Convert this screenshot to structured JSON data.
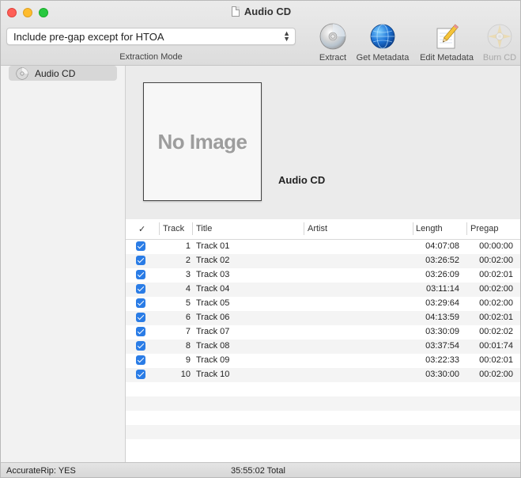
{
  "window": {
    "title": "Audio CD"
  },
  "toolbar": {
    "mode_value": "Include pre-gap except for HTOA",
    "mode_caption": "Extraction Mode",
    "extract_label": "Extract",
    "get_metadata_label": "Get Metadata",
    "edit_metadata_label": "Edit Metadata",
    "burn_cd_label": "Burn CD"
  },
  "sidebar": {
    "items": [
      {
        "label": "Audio CD"
      }
    ]
  },
  "album": {
    "cover_placeholder": "No Image",
    "title": "Audio CD"
  },
  "table": {
    "headers": {
      "check": "✓",
      "track": "Track",
      "title": "Title",
      "artist": "Artist",
      "length": "Length",
      "pregap": "Pregap"
    },
    "rows": [
      {
        "checked": true,
        "track": "1",
        "title": "Track 01",
        "artist": "",
        "length": "04:07:08",
        "pregap": "00:00:00"
      },
      {
        "checked": true,
        "track": "2",
        "title": "Track 02",
        "artist": "",
        "length": "03:26:52",
        "pregap": "00:02:00"
      },
      {
        "checked": true,
        "track": "3",
        "title": "Track 03",
        "artist": "",
        "length": "03:26:09",
        "pregap": "00:02:01"
      },
      {
        "checked": true,
        "track": "4",
        "title": "Track 04",
        "artist": "",
        "length": "03:11:14",
        "pregap": "00:02:00"
      },
      {
        "checked": true,
        "track": "5",
        "title": "Track 05",
        "artist": "",
        "length": "03:29:64",
        "pregap": "00:02:00"
      },
      {
        "checked": true,
        "track": "6",
        "title": "Track 06",
        "artist": "",
        "length": "04:13:59",
        "pregap": "00:02:01"
      },
      {
        "checked": true,
        "track": "7",
        "title": "Track 07",
        "artist": "",
        "length": "03:30:09",
        "pregap": "00:02:02"
      },
      {
        "checked": true,
        "track": "8",
        "title": "Track 08",
        "artist": "",
        "length": "03:37:54",
        "pregap": "00:01:74"
      },
      {
        "checked": true,
        "track": "9",
        "title": "Track 09",
        "artist": "",
        "length": "03:22:33",
        "pregap": "00:02:01"
      },
      {
        "checked": true,
        "track": "10",
        "title": "Track 10",
        "artist": "",
        "length": "03:30:00",
        "pregap": "00:02:00"
      }
    ]
  },
  "status": {
    "accuraterip": "AccurateRip:  YES",
    "total": "35:55:02 Total"
  },
  "colors": {
    "accent": "#2a7ce6",
    "close": "#fe5f57",
    "minimize": "#febc2e",
    "maximize": "#28c840"
  },
  "icons": {
    "extract": "cd-disc-icon",
    "get_metadata": "globe-icon",
    "edit_metadata": "pencil-notepad-icon",
    "burn_cd": "burn-disc-icon"
  }
}
